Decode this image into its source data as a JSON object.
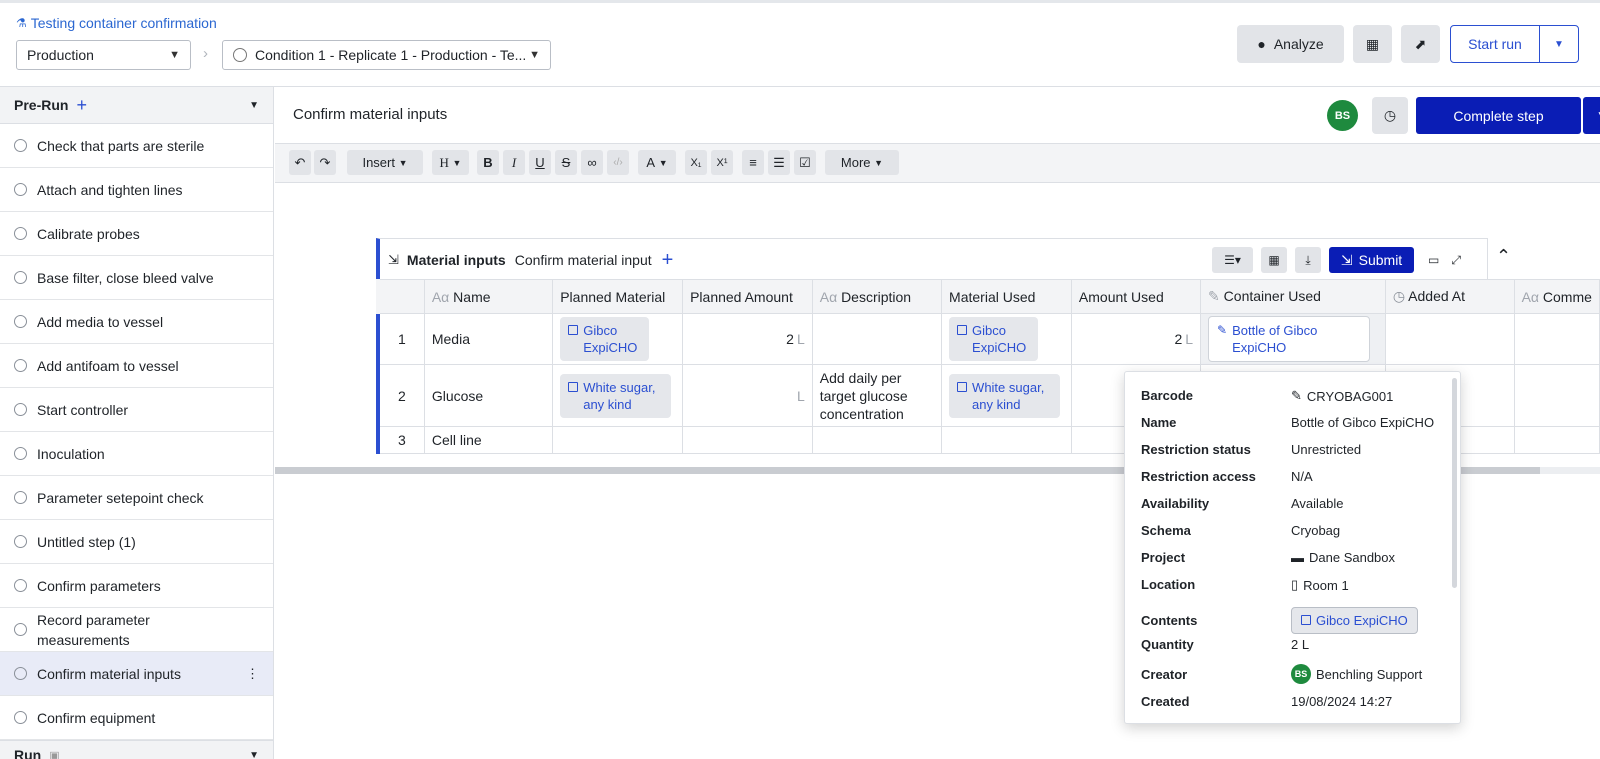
{
  "header": {
    "breadcrumb_link": "Testing container confirmation",
    "env_select": "Production",
    "run_select": "Condition 1 - Replicate 1 - Production - Te...",
    "analyze_label": "Analyze",
    "start_run_label": "Start run"
  },
  "sidebar": {
    "section_title": "Pre-Run",
    "items": [
      {
        "label": "Check that parts are sterile"
      },
      {
        "label": "Attach and tighten lines"
      },
      {
        "label": "Calibrate probes"
      },
      {
        "label": "Base filter, close bleed valve"
      },
      {
        "label": "Add media to vessel"
      },
      {
        "label": "Add antifoam to vessel"
      },
      {
        "label": "Start controller"
      },
      {
        "label": "Inoculation"
      },
      {
        "label": "Parameter setepoint check"
      },
      {
        "label": "Untitled step (1)"
      },
      {
        "label": "Confirm parameters"
      },
      {
        "label": "Record parameter measurements"
      },
      {
        "label": "Confirm material inputs"
      },
      {
        "label": "Confirm equipment"
      }
    ],
    "next_section_title": "Run"
  },
  "step": {
    "title": "Confirm material inputs",
    "avatar": "BS",
    "complete_label": "Complete step"
  },
  "toolbar": {
    "insert": "Insert",
    "heading": "H",
    "bold": "B",
    "italic": "I",
    "underline": "U",
    "strike": "S",
    "text_color": "A",
    "subscript": "X₁",
    "superscript": "X¹",
    "more": "More"
  },
  "material_table": {
    "title": "Material inputs",
    "subtitle": "Confirm material input",
    "submit_label": "Submit",
    "columns": [
      "Name",
      "Planned Material",
      "Planned Amount",
      "Description",
      "Material Used",
      "Amount Used",
      "Container Used",
      "Added At",
      "Comme"
    ],
    "rows": [
      {
        "num": "1",
        "name": "Media",
        "planned_material": "Gibco ExpiCHO",
        "planned_amount": "2",
        "planned_unit": "L",
        "description": "",
        "material_used": "Gibco ExpiCHO",
        "amount_used": "2",
        "amount_unit": "L",
        "container": "Bottle of Gibco ExpiCHO"
      },
      {
        "num": "2",
        "name": "Glucose",
        "planned_material": "White sugar, any kind",
        "planned_amount": "",
        "planned_unit": "L",
        "description": "Add daily per target glucose concentration",
        "material_used": "White sugar, any kind",
        "amount_used": "",
        "amount_unit": "",
        "container": ""
      },
      {
        "num": "3",
        "name": "Cell line",
        "planned_material": "",
        "planned_amount": "",
        "planned_unit": "",
        "description": "",
        "material_used": "",
        "amount_used": "",
        "amount_unit": "",
        "container": ""
      }
    ]
  },
  "popover": {
    "fields": [
      {
        "key": "Barcode",
        "value": "CRYOBAG001"
      },
      {
        "key": "Name",
        "value": "Bottle of Gibco ExpiCHO"
      },
      {
        "key": "Restriction status",
        "value": "Unrestricted"
      },
      {
        "key": "Restriction access",
        "value": "N/A"
      },
      {
        "key": "Availability",
        "value": "Available"
      },
      {
        "key": "Schema",
        "value": "Cryobag"
      },
      {
        "key": "Project",
        "value": "Dane Sandbox"
      },
      {
        "key": "Location",
        "value": "Room 1"
      },
      {
        "key": "Contents",
        "value": "Gibco ExpiCHO"
      },
      {
        "key": "Quantity",
        "value": "2 L"
      },
      {
        "key": "Creator",
        "value": "Benchling Support"
      },
      {
        "key": "Created",
        "value": "19/08/2024 14:27"
      }
    ],
    "creator_avatar": "BS"
  },
  "colors": {
    "accent": "#0a1db5",
    "link": "#2b67d1",
    "avatar": "#1e8a3e"
  }
}
